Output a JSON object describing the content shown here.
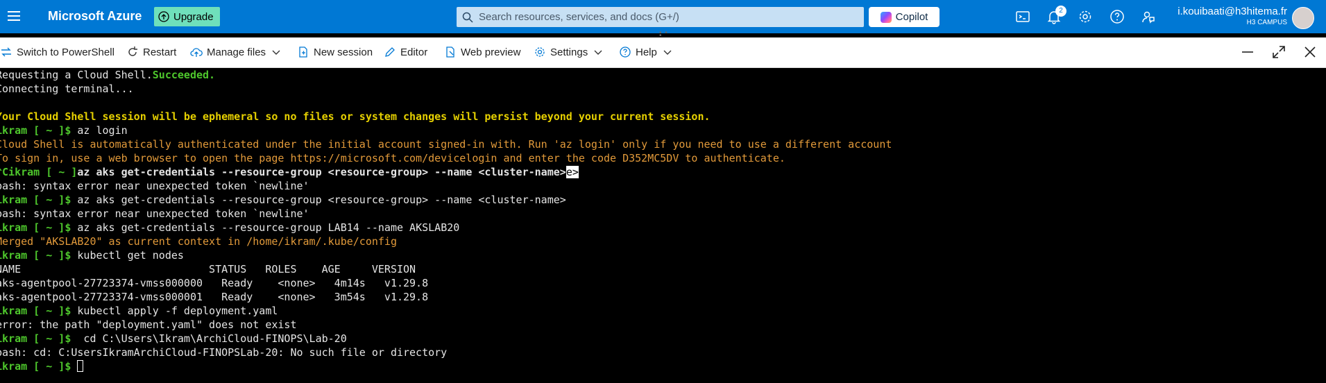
{
  "topbar": {
    "brand": "Microsoft Azure",
    "upgrade_label": "Upgrade",
    "search_placeholder": "Search resources, services, and docs (G+/)",
    "copilot_label": "Copilot",
    "notifications_count": "2",
    "user_email": "i.kouibaati@h3hitema.fr",
    "user_directory": "H3 CAMPUS",
    "icons": [
      "cloud-shell-icon",
      "notifications-icon",
      "settings-icon",
      "help-icon",
      "feedback-icon"
    ]
  },
  "toolbar": {
    "switch_label": "Switch to PowerShell",
    "restart_label": "Restart",
    "manage_files_label": "Manage files",
    "new_session_label": "New session",
    "editor_label": "Editor",
    "web_preview_label": "Web preview",
    "settings_label": "Settings",
    "help_label": "Help"
  },
  "terminal": {
    "l1_pre": "Requesting a Cloud Shell.",
    "l1_status": "Succeeded.",
    "l2": "Connecting terminal...",
    "l4": "Your Cloud Shell session will be ephemeral so no files or system changes will persist beyond your current session.",
    "prompt": "ikram [ ~ ]$",
    "cmd_login": " az login",
    "login_info1": "Cloud Shell is automatically authenticated under the initial account signed-in with. Run 'az login' only if you need to use a different account",
    "login_info2": "To sign in, use a web browser to open the page https://microsoft.com/devicelogin and enter the code D352MC5DV to authenticate.",
    "ctrl_prompt": "^Cikram [ ~ ]",
    "cmd_getcred1": "az aks get-credentials --resource-group <resource-group> --name <cluster-name>",
    "cmd_getcred1_hl": "e>",
    "err_syntax": "bash: syntax error near unexpected token `newline'",
    "cmd_getcred2": " az aks get-credentials --resource-group <resource-group> --name <cluster-name>",
    "cmd_getcred3": " az aks get-credentials --resource-group LAB14 --name AKSLAB20",
    "merged": "Merged \"AKSLAB20\" as current context in /home/ikram/.kube/config",
    "cmd_getnodes": " kubectl get nodes",
    "nodes_header": "NAME                              STATUS   ROLES    AGE     VERSION",
    "nodes": [
      "aks-agentpool-27723374-vmss000000   Ready    <none>   4m14s   v1.29.8",
      "aks-agentpool-27723374-vmss000001   Ready    <none>   3m54s   v1.29.8"
    ],
    "cmd_apply": " kubectl apply -f deployment.yaml",
    "err_apply": "error: the path \"deployment.yaml\" does not exist",
    "cmd_cd": "  cd C:\\Users\\Ikram\\ArchiCloud-FINOPS\\Lab-20",
    "err_cd": "bash: cd: C:UsersIkramArchiCloud-FINOPSLab-20: No such file or directory"
  }
}
